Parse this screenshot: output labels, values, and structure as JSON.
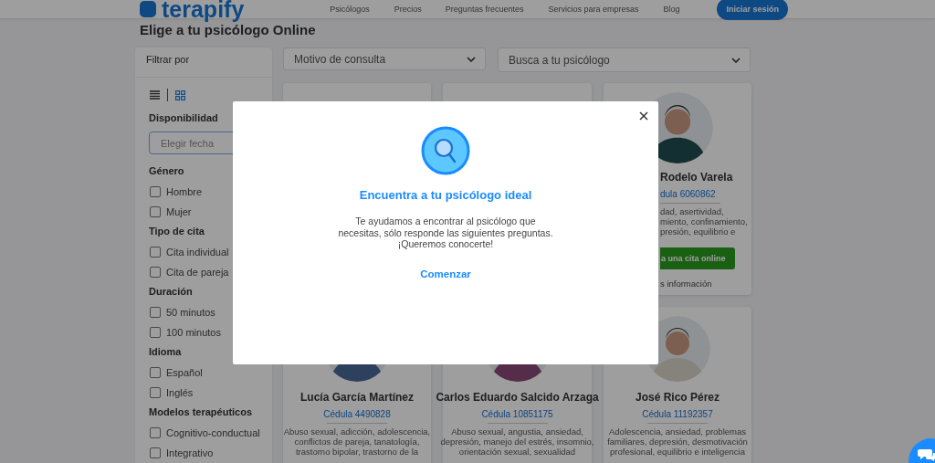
{
  "header": {
    "logo": "terapify",
    "nav": [
      "Psicólogos",
      "Precios",
      "Preguntas frecuentes",
      "Servicios para empresas",
      "Blog"
    ],
    "login_button": "Iniciar sesión"
  },
  "page_title": "Elige a tu psicólogo Online",
  "sidebar": {
    "title": "Filtrar por",
    "view_modes": [
      {
        "kind": "list",
        "selected": false
      },
      {
        "kind": "grid",
        "selected": true
      }
    ],
    "groups": [
      {
        "title": "Disponibilidad",
        "kind": "date",
        "placeholder": "Elegir fecha"
      },
      {
        "title": "Género",
        "kind": "checks",
        "options": [
          {
            "label": "Hombre",
            "checked": false
          },
          {
            "label": "Mujer",
            "checked": false
          }
        ]
      },
      {
        "title": "Tipo de cita",
        "kind": "checks",
        "options": [
          {
            "label": "Cita individual",
            "checked": false
          },
          {
            "label": "Cita de pareja",
            "checked": false
          }
        ]
      },
      {
        "title": "Duración",
        "kind": "checks",
        "options": [
          {
            "label": "50 minutos",
            "checked": false
          },
          {
            "label": "100 minutos",
            "checked": false
          }
        ]
      },
      {
        "title": "Idioma",
        "kind": "checks",
        "options": [
          {
            "label": "Español",
            "checked": false
          },
          {
            "label": "Inglés",
            "checked": false
          }
        ]
      },
      {
        "title": "Modelos terapéuticos",
        "kind": "checks",
        "options": [
          {
            "label": "Cognitivo-conductual",
            "checked": false
          },
          {
            "label": "Integrativo",
            "checked": false
          }
        ]
      }
    ]
  },
  "filters": [
    {
      "label": "Motivo de consulta"
    },
    {
      "label": "Busca a tu psicólogo"
    }
  ],
  "psychologists": [
    {
      "kind": "covered"
    },
    {
      "kind": "covered"
    },
    {
      "kind": "cut",
      "name": "Rodelo Varela",
      "license": "dula 6060862",
      "specialties": "dad, asertividad,\nmiento, confinamiento,\npresión, equilibrio e",
      "book_button": "a una cita online",
      "more_link": "s información"
    },
    {
      "kind": "full",
      "name": "Lucía García Martínez",
      "license": "Cédula 4490828",
      "specialties": "Abuso sexual, adicción, adolescencia,\nconflictos de pareja, tanatología,\ntrastorno bipolar, trastorno de la"
    },
    {
      "kind": "full",
      "name": "Carlos Eduardo Salcido Arzaga",
      "license": "Cédula 10851175",
      "specialties": "Abuso sexual, angustia, ansiedad,\ndepresión, manejo del estrés, insomnio,\norientación sexual, sexualidad"
    },
    {
      "kind": "full",
      "name": "José Rico Pérez",
      "license": "Cédula 11192357",
      "specialties": "Adolescencia, ansiedad, problemas\nfamiliares, depresión, desmotivación\nprofesional, equilibrio e inteligencia"
    }
  ],
  "modal": {
    "title": "Encuentra a tu psicólogo ideal",
    "text": "Te ayudamos a encontrar al psicólogo que\nnecesitas, sólo responde las siguientes preguntas.\n¡Queremos conocerte!",
    "start_button": "Comenzar"
  }
}
